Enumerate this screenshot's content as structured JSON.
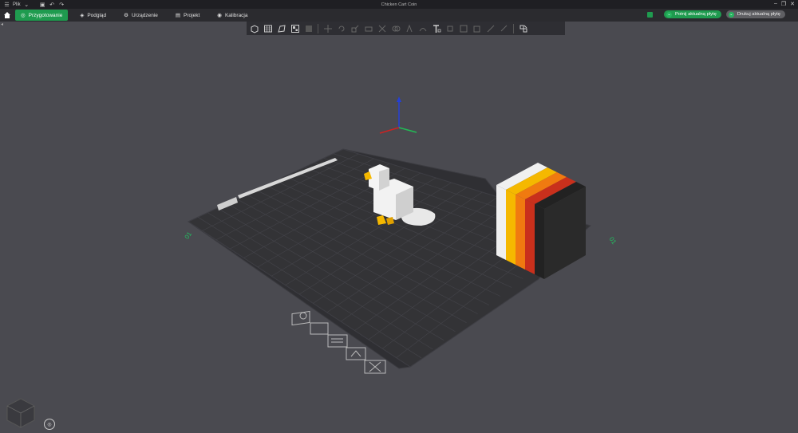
{
  "titlebar": {
    "menu_label": "Plik",
    "title": "Chicken Cart Coin"
  },
  "tabs": [
    {
      "label": "Przygotowanie",
      "icon": "prepare-icon",
      "active": true
    },
    {
      "label": "Podgląd",
      "icon": "preview-icon",
      "active": false
    },
    {
      "label": "Urządzenie",
      "icon": "device-icon",
      "active": false
    },
    {
      "label": "Projekt",
      "icon": "project-icon",
      "active": false
    },
    {
      "label": "Kalibracja",
      "icon": "calibration-icon",
      "active": false
    }
  ],
  "actions": {
    "slice_label": "Potnij aktualną płytę",
    "print_label": "Drukuj aktualną płytę"
  },
  "plate": {
    "left_label": "01",
    "right_label": "01"
  },
  "colors": {
    "accent": "#1f9b4f",
    "bed": "#333336",
    "background": "#4a4a50",
    "stripes": [
      "#f0f0f0",
      "#f5b800",
      "#f07a10",
      "#c9301c",
      "#222222"
    ]
  }
}
